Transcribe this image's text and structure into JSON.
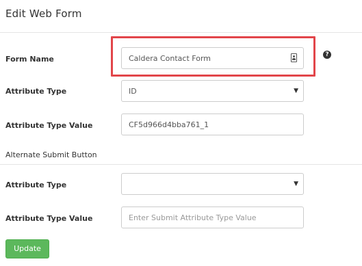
{
  "header": {
    "title": "Edit Web Form"
  },
  "form": {
    "form_name": {
      "label": "Form Name",
      "value": "Caldera Contact Form",
      "help_icon": "question-circle-icon",
      "field_icon": "contact-card-icon"
    },
    "attribute_type": {
      "label": "Attribute Type",
      "value": "ID"
    },
    "attribute_type_value": {
      "label": "Attribute Type Value",
      "value": "CF5d966d4bba761_1"
    }
  },
  "alternate_submit": {
    "section_label": "Alternate Submit Button",
    "attribute_type": {
      "label": "Attribute Type",
      "value": ""
    },
    "attribute_type_value": {
      "label": "Attribute Type Value",
      "value": "",
      "placeholder": "Enter Submit Attribute Type Value"
    }
  },
  "actions": {
    "update_label": "Update"
  },
  "colors": {
    "highlight": "#e2454a",
    "update_button": "#5cb85c"
  }
}
